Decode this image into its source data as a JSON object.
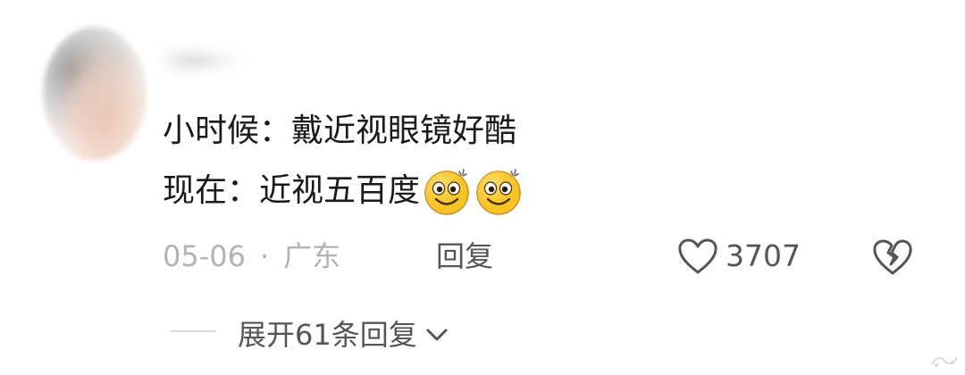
{
  "comment": {
    "content_line1": "小时候：戴近视眼镜好酷",
    "content_line2": "现在：近视五百度",
    "emojis": [
      "silly-grin-emoji",
      "silly-grin-emoji"
    ],
    "date": "05-06",
    "separator": "·",
    "location": "广东",
    "reply_label": "回复",
    "like_count": "3707",
    "expand_label": "展开61条回复"
  },
  "icons": {
    "like": "heart-outline-icon",
    "dislike": "broken-heart-icon",
    "expand": "chevron-down-icon"
  },
  "colors": {
    "text_primary": "#1a1a1a",
    "text_meta": "#b3b3b3",
    "text_action": "#555555",
    "emoji_yellow": "#f7c325"
  }
}
